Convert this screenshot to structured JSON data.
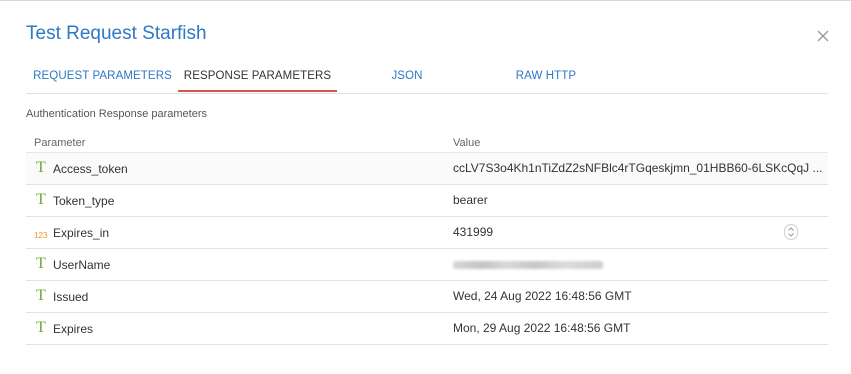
{
  "dialog": {
    "title": "Test Request Starfish"
  },
  "tabs": [
    {
      "label": "REQUEST PARAMETERS",
      "active": false
    },
    {
      "label": "RESPONSE PARAMETERS",
      "active": true
    },
    {
      "label": "JSON",
      "active": false
    },
    {
      "label": "RAW HTTP",
      "active": false
    }
  ],
  "section": {
    "label": "Authentication Response parameters"
  },
  "table": {
    "headers": {
      "parameter": "Parameter",
      "value": "Value"
    },
    "rows": [
      {
        "type": "text",
        "type_icon": "T",
        "name": "Access_token",
        "value": "ccLV7S3o4Kh1nTiZdZ2sNFBlc4rTGqeskjmn_01HBB60-6LSKcQqJ ..."
      },
      {
        "type": "text",
        "type_icon": "T",
        "name": "Token_type",
        "value": "bearer"
      },
      {
        "type": "number",
        "type_icon": "123",
        "name": "Expires_in",
        "value": "431999"
      },
      {
        "type": "text",
        "type_icon": "T",
        "name": "UserName",
        "value": ""
      },
      {
        "type": "text",
        "type_icon": "T",
        "name": "Issued",
        "value": "Wed, 24 Aug 2022 16:48:56 GMT"
      },
      {
        "type": "text",
        "type_icon": "T",
        "name": "Expires",
        "value": "Mon, 29 Aug 2022 16:48:56 GMT"
      }
    ]
  },
  "colors": {
    "accent": "#2d78c7",
    "active_tab_underline": "#d9534f",
    "text_type_icon": "#6aa733",
    "number_type_icon": "#f0963a"
  }
}
